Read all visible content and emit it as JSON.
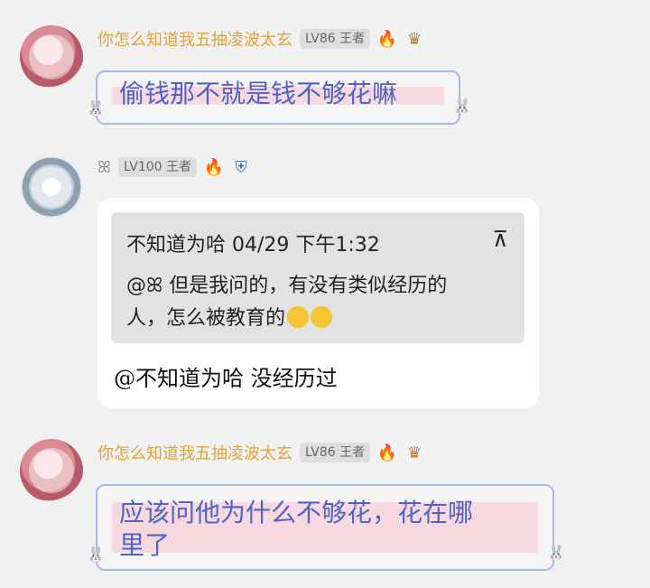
{
  "messages": [
    {
      "sender": "你怎么知道我五抽凌波太玄",
      "level": "LV86 王者",
      "text_lines": [
        "偷钱那不就是钱不够花嘛"
      ]
    },
    {
      "sender": "ꕤ",
      "level": "LV100 王者",
      "quote_header": "不知道为哈 04/29 下午1:32",
      "quote_arrow": "⊼",
      "quote_line1": "@ꕤ  但是我问的，有没有类似经历的",
      "quote_line2": "人，怎么被教育的",
      "reply": "@不知道为哈 没经历过"
    },
    {
      "sender": "你怎么知道我五抽凌波太玄",
      "level": "LV86 王者",
      "text_lines": [
        "应该问他为什么不够花，花在哪",
        "里了"
      ]
    }
  ],
  "icons": {
    "fire": "🔥",
    "crown": "♛",
    "flame_small": "🔥",
    "shield": "⛨"
  },
  "colors": {
    "background": "#f1f1f1",
    "nickname": "#e2a236",
    "bubble_text": "#4d64c6",
    "highlight": "#f8d8df"
  }
}
